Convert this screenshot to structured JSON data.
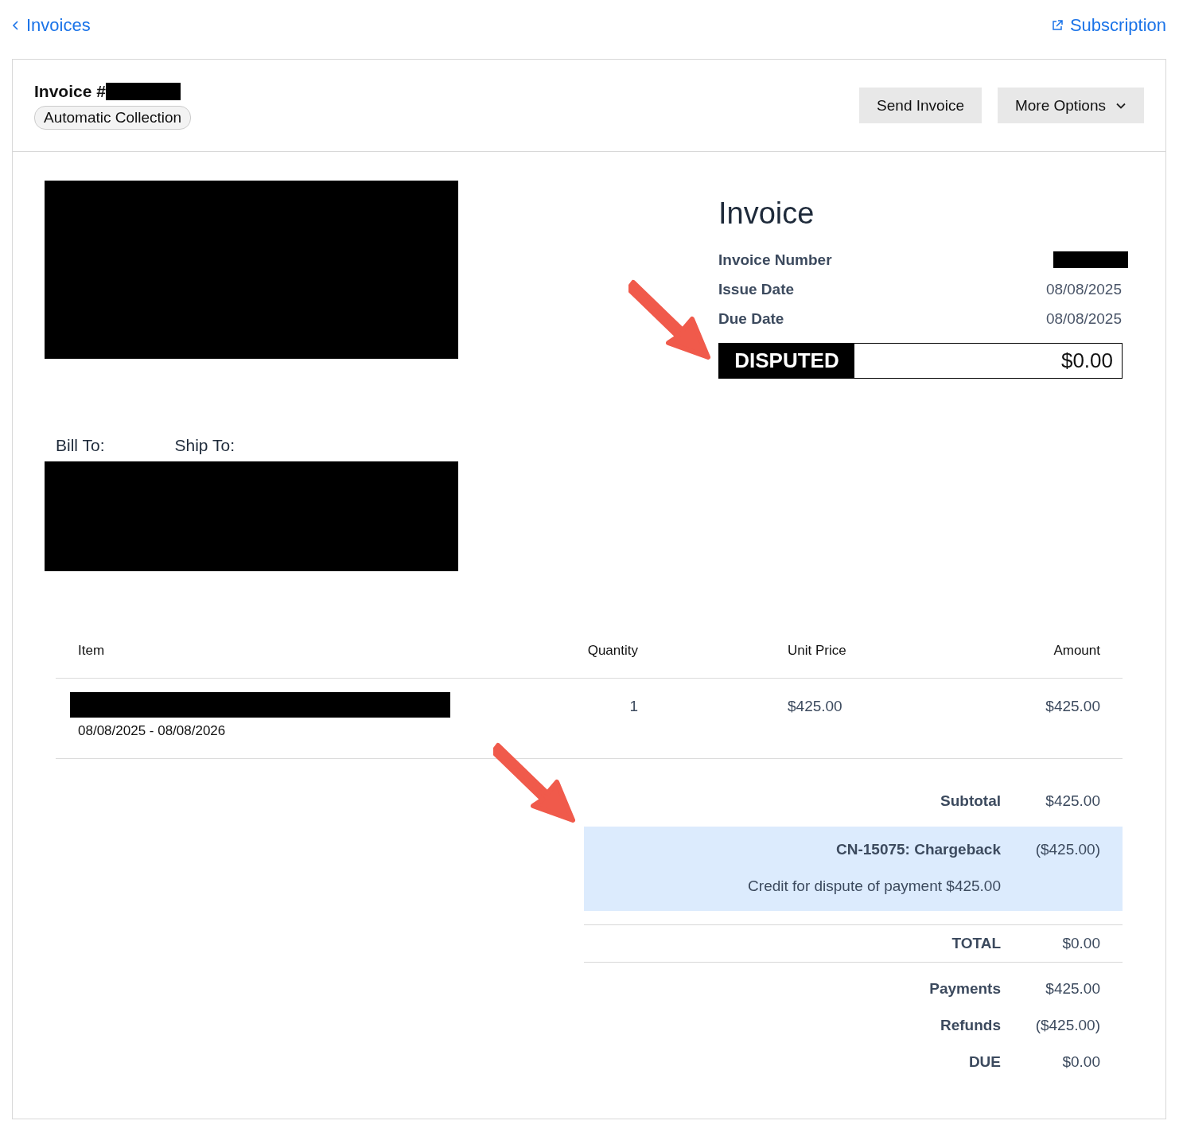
{
  "nav": {
    "back": "Invoices",
    "subscription": "Subscription"
  },
  "header": {
    "title": "Invoice #",
    "tag": "Automatic Collection",
    "buttons": [
      {
        "label": "Send Invoice",
        "dropdown": false
      },
      {
        "label": "More Options",
        "dropdown": true
      }
    ]
  },
  "summary": {
    "title": "Invoice",
    "rows": [
      {
        "kind": "redacted",
        "label": "Invoice Number"
      },
      {
        "kind": "text",
        "label": "Issue Date",
        "value": "08/08/2025"
      },
      {
        "kind": "text",
        "label": "Due Date",
        "value": "08/08/2025"
      }
    ],
    "status": "DISPUTED",
    "amount": "$0.00"
  },
  "addresses": {
    "bill_to": "Bill To:",
    "ship_to": "Ship To:"
  },
  "table": {
    "columns": [
      "Item",
      "Quantity",
      "Unit Price",
      "Amount"
    ],
    "rows": [
      {
        "period": "08/08/2025 - 08/08/2026",
        "quantity": "1",
        "unit_price": "$425.00",
        "amount": "$425.00"
      }
    ]
  },
  "totals": [
    {
      "kind": "line",
      "label": "Subtotal",
      "value": "$425.00"
    },
    {
      "kind": "credit",
      "label": "CN-15075: Chargeback",
      "value": "($425.00)",
      "note": "Credit for dispute of payment $425.00"
    },
    {
      "kind": "total",
      "label": "TOTAL",
      "value": "$0.00"
    },
    {
      "kind": "line",
      "label": "Payments",
      "value": "$425.00"
    },
    {
      "kind": "line",
      "label": "Refunds",
      "value": "($425.00)"
    },
    {
      "kind": "line",
      "label": "DUE",
      "value": "$0.00"
    }
  ]
}
